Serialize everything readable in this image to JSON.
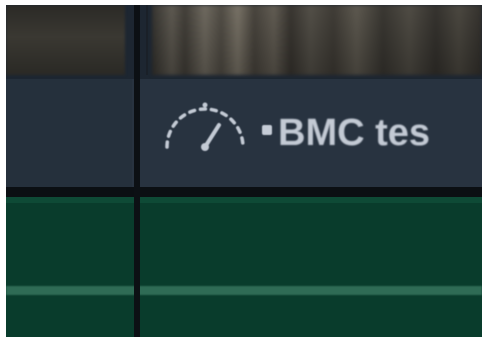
{
  "clip": {
    "title": "BMC tes"
  },
  "icons": {
    "speed": "speedometer-icon",
    "marker": "marker-dot-icon"
  },
  "colors": {
    "panel_bg": "#283340",
    "track_green": "#093c2c",
    "track_line": "#2f6b55",
    "title_text": "#c3cad4"
  }
}
